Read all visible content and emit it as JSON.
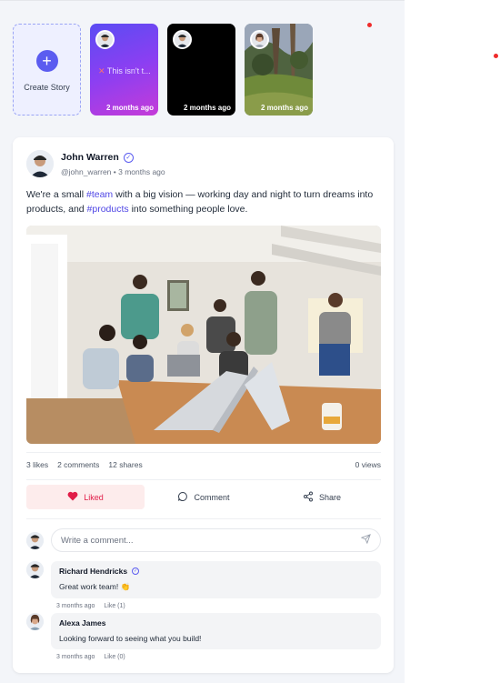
{
  "stories": {
    "create_label": "Create Story",
    "items": [
      {
        "text": "This isn't t...",
        "time": "2 months ago"
      },
      {
        "text": "",
        "time": "2 months ago"
      },
      {
        "text": "",
        "time": "2 months ago"
      }
    ]
  },
  "post": {
    "author_name": "John Warren",
    "handle": "@john_warren",
    "time": "3 months ago",
    "text_part1": "We're a small ",
    "tag1": "#team",
    "text_part2": " with a big vision — working day and night to turn dreams into products, and ",
    "tag2": "#products",
    "text_part3": " into something people love.",
    "stats": {
      "likes": "3 likes",
      "comments": "2 comments",
      "shares": "12 shares",
      "views": "0 views"
    },
    "actions": {
      "like": "Liked",
      "comment": "Comment",
      "share": "Share"
    },
    "comment_placeholder": "Write a comment...",
    "comments": [
      {
        "name": "Richard Hendricks",
        "text": "Great work team! 👏",
        "time": "3 months ago",
        "like": "Like (1)"
      },
      {
        "name": "Alexa James",
        "text": "Looking forward to seeing what you build!",
        "time": "3 months ago",
        "like": "Like (0)"
      }
    ]
  },
  "colors": {
    "accent": "#5b5cf0",
    "liked": "#e11d48",
    "dot": "#ef2b2b"
  }
}
